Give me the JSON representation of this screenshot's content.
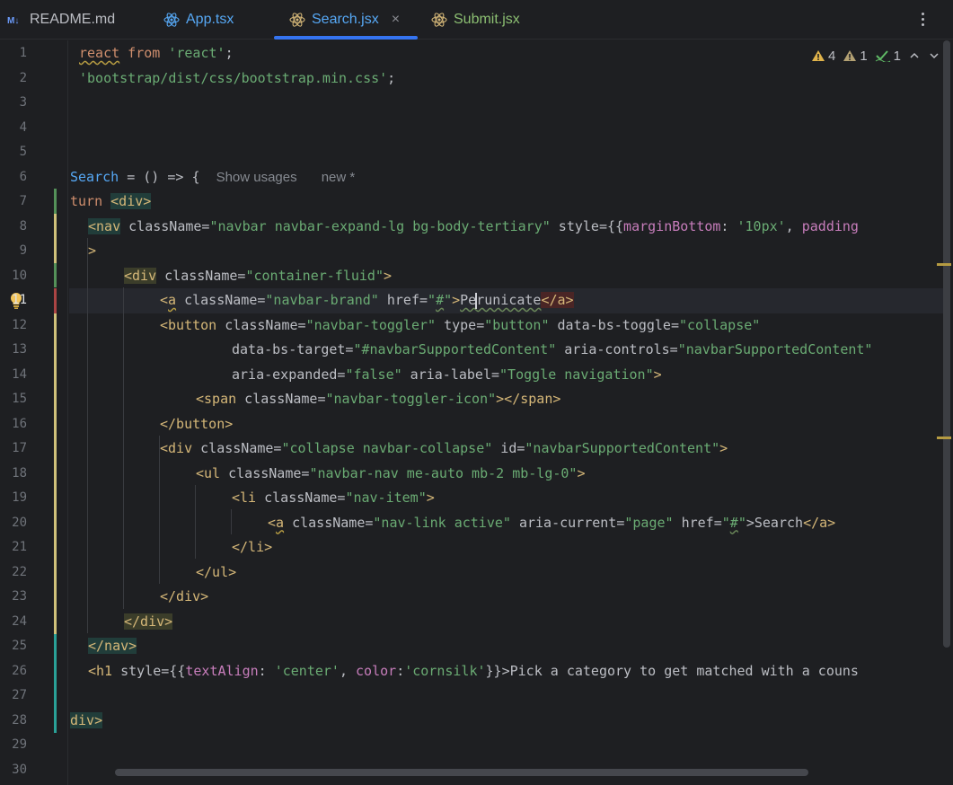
{
  "tabs": [
    {
      "label": "README.md",
      "icon": "markdown-icon",
      "active": false
    },
    {
      "label": "App.tsx",
      "icon": "react-icon",
      "active": false
    },
    {
      "label": "Search.jsx",
      "icon": "react-icon",
      "active": true
    },
    {
      "label": "Submit.jsx",
      "icon": "react-icon",
      "active": false
    }
  ],
  "tab_close_glyph": "×",
  "inspections": {
    "warnings": "4",
    "weak_warnings": "1",
    "ok": "1"
  },
  "line_numbers": [
    "1",
    "2",
    "3",
    "4",
    "5",
    "6",
    "7",
    "8",
    "9",
    "10",
    "11",
    "12",
    "13",
    "14",
    "15",
    "16",
    "17",
    "18",
    "19",
    "20",
    "21",
    "22",
    "23",
    "24",
    "25",
    "26",
    "27",
    "28",
    "29",
    "30"
  ],
  "current_line": "11",
  "hints": {
    "usages": "Show usages",
    "author": "new *"
  },
  "code": {
    "l1a": "react",
    "l1b": " from ",
    "l1c": "'react'",
    "l1d": ";",
    "l2a": "'bootstrap/dist/css/bootstrap.min.css'",
    "l2b": ";",
    "l6a": "Search",
    "l6b": " = () => {",
    "l7a": "turn ",
    "l7b": "<div>",
    "l8a": "<nav",
    "l8b": " className=",
    "l8c": "\"navbar navbar-expand-lg bg-body-tertiary\"",
    "l8d": " style={{",
    "l8e": "marginBottom",
    "l8f": ": ",
    "l8g": "'10px'",
    "l8h": ", ",
    "l8i": "padding",
    "l9a": ">",
    "l10a": "<div",
    "l10b": " className=",
    "l10c": "\"container-fluid\"",
    "l10d": ">",
    "l11a": "<",
    "l11b": "a",
    "l11c": " className=",
    "l11d": "\"navbar-brand\"",
    "l11e": " href=",
    "l11f": "\"",
    "l11g": "#",
    "l11h": "\"",
    "l11i": ">",
    "l11j": "Pe",
    "l11k": "runicate",
    "l11l": "</a>",
    "l12a": "<button",
    "l12b": " className=",
    "l12c": "\"navbar-toggler\"",
    "l12d": " type=",
    "l12e": "\"button\"",
    "l12f": " data-bs-toggle=",
    "l12g": "\"collapse\"",
    "l13a": "data-bs-target=",
    "l13b": "\"#navbarSupportedContent\"",
    "l13c": " aria-controls=",
    "l13d": "\"navbarSupportedContent\"",
    "l14a": "aria-expanded=",
    "l14b": "\"false\"",
    "l14c": " aria-label=",
    "l14d": "\"Toggle navigation\"",
    "l14e": ">",
    "l15a": "<span",
    "l15b": " className=",
    "l15c": "\"navbar-toggler-icon\"",
    "l15d": "></span>",
    "l16a": "</button>",
    "l17a": "<div",
    "l17b": " className=",
    "l17c": "\"collapse navbar-collapse\"",
    "l17d": " id=",
    "l17e": "\"navbarSupportedContent\"",
    "l17f": ">",
    "l18a": "<ul",
    "l18b": " className=",
    "l18c": "\"navbar-nav me-auto mb-2 mb-lg-0\"",
    "l18d": ">",
    "l19a": "<li",
    "l19b": " className=",
    "l19c": "\"nav-item\"",
    "l19d": ">",
    "l20a": "<",
    "l20b": "a",
    "l20c": " className=",
    "l20d": "\"nav-link active\"",
    "l20e": " aria-current=",
    "l20f": "\"page\"",
    "l20g": " href=",
    "l20h": "\"",
    "l20i": "#",
    "l20j": "\"",
    "l20k": ">Search",
    "l20l": "</a>",
    "l21a": "</li>",
    "l22a": "</ul>",
    "l23a": "</div>",
    "l24a": "</div>",
    "l25a": "</nav>",
    "l26a": "<h1",
    "l26b": " style={{",
    "l26c": "textAlign",
    "l26d": ": ",
    "l26e": "'center'",
    "l26f": ", ",
    "l26g": "color",
    "l26h": ":",
    "l26i": "'cornsilk'",
    "l26j": "}}>Pick a category to get matched with a couns",
    "l28a": "div>"
  },
  "colors": {
    "accent": "#3574f0",
    "tag": "#d5b778",
    "string": "#6aab73",
    "keyword": "#cf8e6d",
    "function": "#56a8f5",
    "property": "#c77dbb",
    "warning": "#e0b34b"
  }
}
